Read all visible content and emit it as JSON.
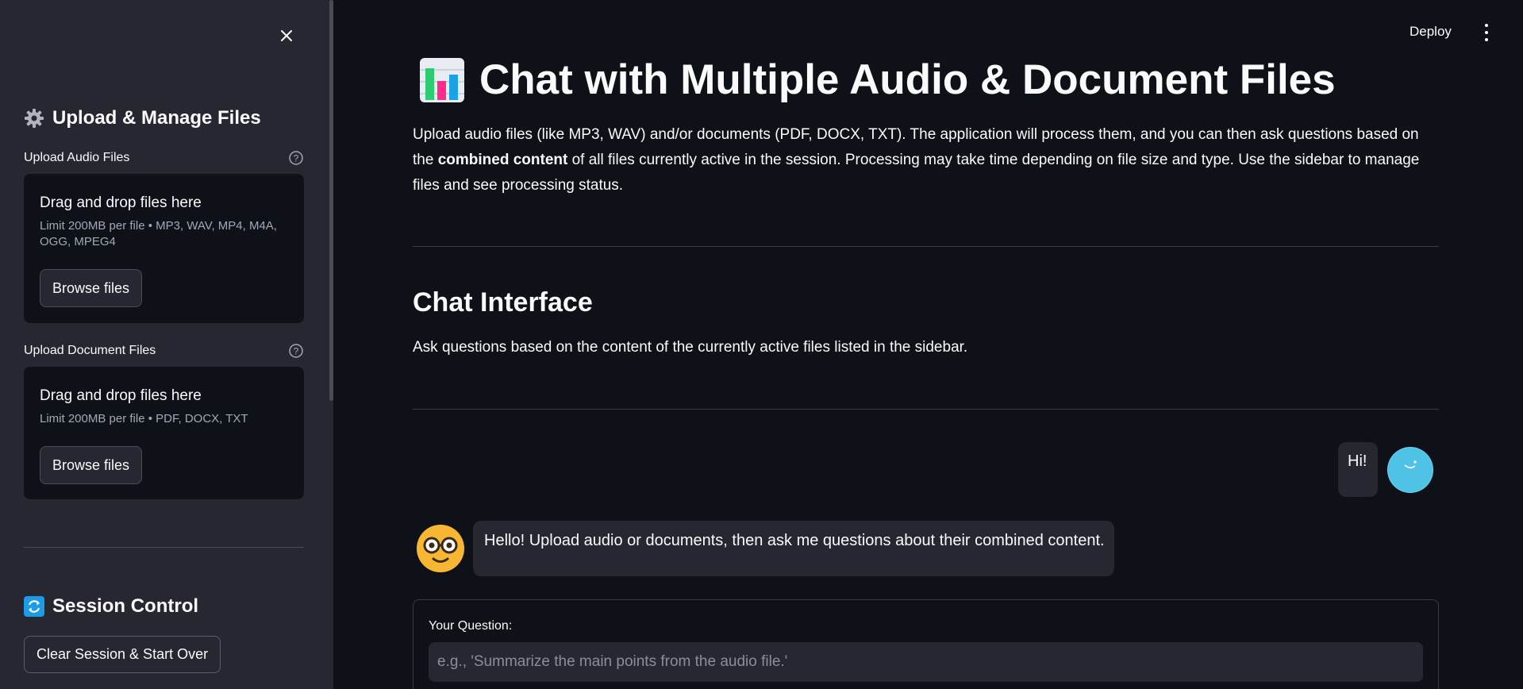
{
  "topbar": {
    "deploy_label": "Deploy"
  },
  "sidebar": {
    "header_title": "Upload & Manage Files",
    "audio": {
      "label": "Upload Audio Files",
      "drop_title": "Drag and drop files here",
      "limit": "Limit 200MB per file • MP3, WAV, MP4, M4A, OGG, MPEG4",
      "browse_label": "Browse files"
    },
    "docs": {
      "label": "Upload Document Files",
      "drop_title": "Drag and drop files here",
      "limit": "Limit 200MB per file • PDF, DOCX, TXT",
      "browse_label": "Browse files"
    },
    "session_title": "Session Control",
    "clear_label": "Clear Session & Start Over"
  },
  "main": {
    "title": "Chat with Multiple Audio & Document Files",
    "intro_part1": "Upload audio files (like MP3, WAV) and/or documents (PDF, DOCX, TXT). The application will process them, and you can then ask questions based on the ",
    "intro_bold": "combined content",
    "intro_part2": " of all files currently active in the session. Processing may take time depending on file size and type. Use the sidebar to manage files and see processing status.",
    "chat_heading": "Chat Interface",
    "chat_subtext": "Ask questions based on the content of the currently active files listed in the sidebar.",
    "messages": [
      {
        "role": "user",
        "text": "Hi!"
      },
      {
        "role": "assistant",
        "text": "Hello! Upload audio or documents, then ask me questions about their combined content."
      }
    ],
    "question_label": "Your Question:",
    "question_placeholder": "e.g., 'Summarize the main points from the audio file.'"
  }
}
